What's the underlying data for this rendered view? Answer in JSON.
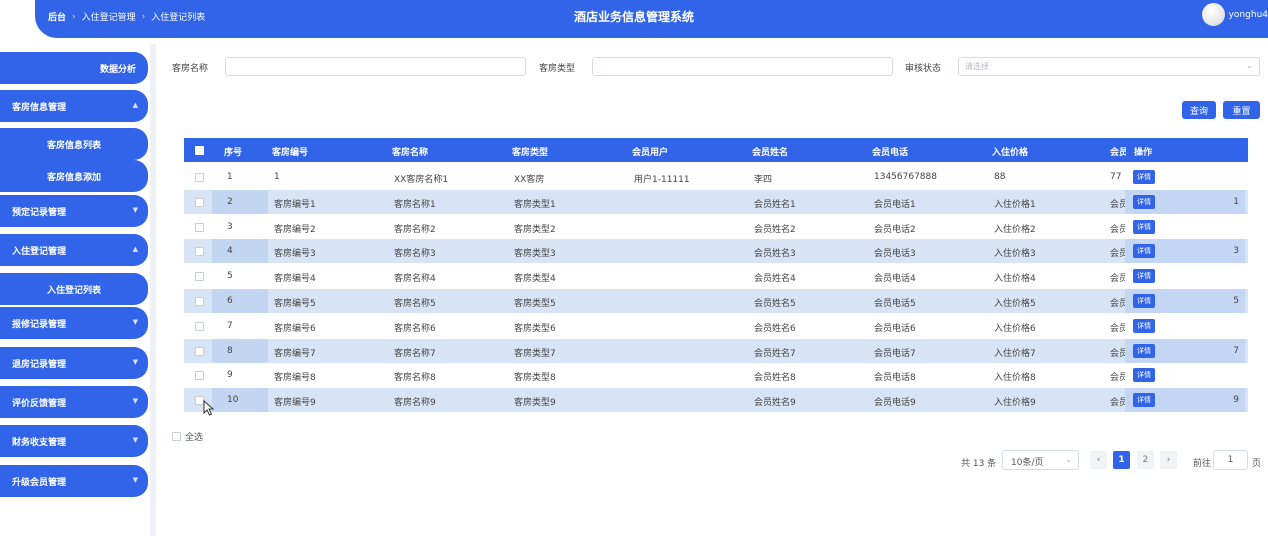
{
  "header": {
    "breadcrumb": [
      "后台",
      "入住登记管理",
      "入住登记列表"
    ],
    "separator": "›",
    "title": "酒店业务信息管理系统",
    "username": "yonghu4"
  },
  "sidebar": {
    "items": [
      {
        "label": "数据分析"
      },
      {
        "label": "客房信息管理",
        "caret": "▲"
      },
      {
        "label": "客房信息列表"
      },
      {
        "label": "客房信息添加"
      },
      {
        "label": "预定记录管理",
        "caret": "▼"
      },
      {
        "label": "入住登记管理",
        "caret": "▲"
      },
      {
        "label": "入住登记列表"
      },
      {
        "label": "报修记录管理",
        "caret": "▼"
      },
      {
        "label": "退房记录管理",
        "caret": "▼"
      },
      {
        "label": "评价反馈管理",
        "caret": "▼"
      },
      {
        "label": "财务收支管理",
        "caret": "▼"
      },
      {
        "label": "升级会员管理",
        "caret": "▼"
      }
    ]
  },
  "filters": {
    "room_name_label": "客房名称",
    "room_name_value": "",
    "room_type_label": "客房类型",
    "room_type_value": "",
    "status_label": "审核状态",
    "status_placeholder": "请选择",
    "arrow": "⌄"
  },
  "buttons": {
    "query": "查询",
    "reset": "重置"
  },
  "table": {
    "columns": [
      "序号",
      "客房编号",
      "客房名称",
      "客房类型",
      "会员用户",
      "会员姓名",
      "会员电话",
      "入住价格",
      "会员",
      "操作"
    ],
    "detail_label": "详情",
    "rows": [
      {
        "idx": "1",
        "code": "1",
        "name": "XX客房名称1",
        "type": "XX客房",
        "user": "用户1-11111",
        "mname": "李四",
        "phone": "13456767888",
        "price": "88",
        "level": "77",
        "extra": ""
      },
      {
        "idx": "2",
        "code": "客房编号1",
        "name": "客房名称1",
        "type": "客房类型1",
        "user": "",
        "mname": "会员姓名1",
        "phone": "会员电话1",
        "price": "入住价格1",
        "level": "会员",
        "extra": "1"
      },
      {
        "idx": "3",
        "code": "客房编号2",
        "name": "客房名称2",
        "type": "客房类型2",
        "user": "",
        "mname": "会员姓名2",
        "phone": "会员电话2",
        "price": "入住价格2",
        "level": "会员",
        "extra": ""
      },
      {
        "idx": "4",
        "code": "客房编号3",
        "name": "客房名称3",
        "type": "客房类型3",
        "user": "",
        "mname": "会员姓名3",
        "phone": "会员电话3",
        "price": "入住价格3",
        "level": "会员",
        "extra": "3"
      },
      {
        "idx": "5",
        "code": "客房编号4",
        "name": "客房名称4",
        "type": "客房类型4",
        "user": "",
        "mname": "会员姓名4",
        "phone": "会员电话4",
        "price": "入住价格4",
        "level": "会员",
        "extra": ""
      },
      {
        "idx": "6",
        "code": "客房编号5",
        "name": "客房名称5",
        "type": "客房类型5",
        "user": "",
        "mname": "会员姓名5",
        "phone": "会员电话5",
        "price": "入住价格5",
        "level": "会员",
        "extra": "5"
      },
      {
        "idx": "7",
        "code": "客房编号6",
        "name": "客房名称6",
        "type": "客房类型6",
        "user": "",
        "mname": "会员姓名6",
        "phone": "会员电话6",
        "price": "入住价格6",
        "level": "会员",
        "extra": ""
      },
      {
        "idx": "8",
        "code": "客房编号7",
        "name": "客房名称7",
        "type": "客房类型7",
        "user": "",
        "mname": "会员姓名7",
        "phone": "会员电话7",
        "price": "入住价格7",
        "level": "会员",
        "extra": "7"
      },
      {
        "idx": "9",
        "code": "客房编号8",
        "name": "客房名称8",
        "type": "客房类型8",
        "user": "",
        "mname": "会员姓名8",
        "phone": "会员电话8",
        "price": "入住价格8",
        "level": "会员",
        "extra": ""
      },
      {
        "idx": "10",
        "code": "客房编号9",
        "name": "客房名称9",
        "type": "客房类型9",
        "user": "",
        "mname": "会员姓名9",
        "phone": "会员电话9",
        "price": "入住价格9",
        "level": "会员",
        "extra": "9"
      }
    ]
  },
  "select_all_label": "全选",
  "pagination": {
    "total": "共 13 条",
    "page_size": "10条/页",
    "prev": "‹",
    "pages": [
      "1",
      "2"
    ],
    "next": "›",
    "goto_label": "前往",
    "goto_value": "1",
    "suffix": "页"
  },
  "colors": {
    "primary": "#3164e8",
    "stripe": "#d7e4f6"
  }
}
